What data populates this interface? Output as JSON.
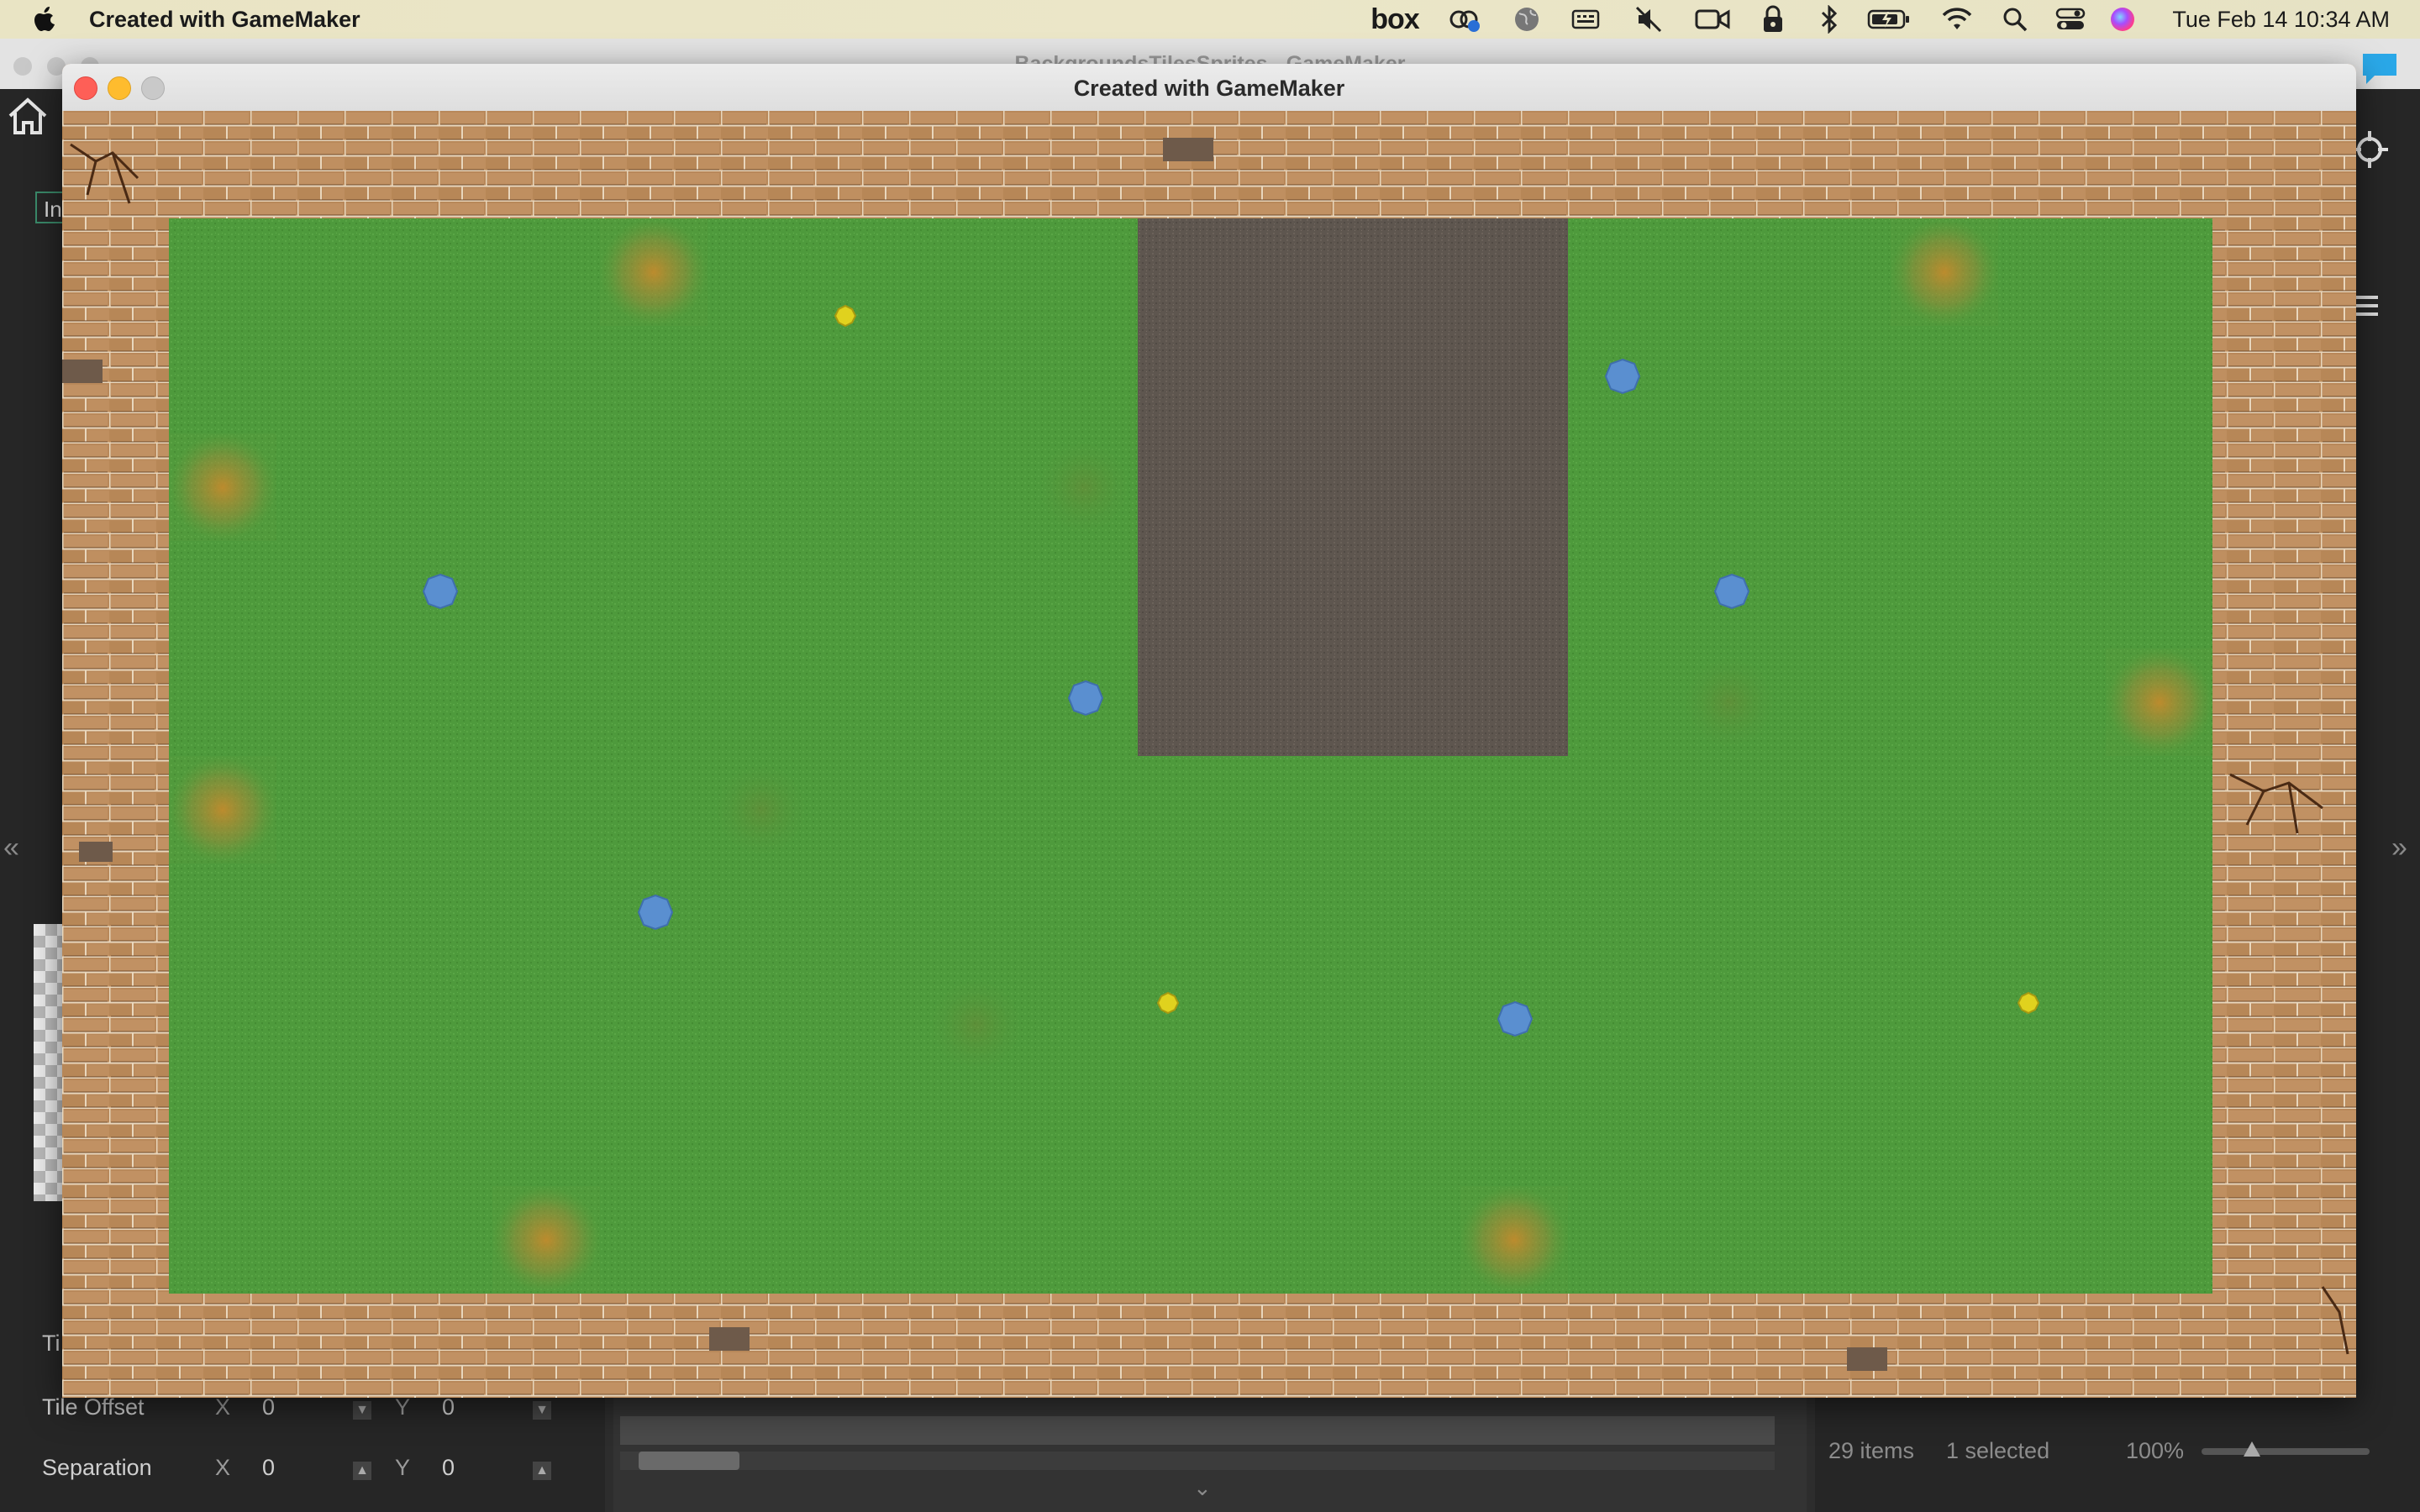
{
  "menubar": {
    "app_name": "Created with GameMaker",
    "box_label": "box",
    "clock": "Tue Feb 14  10:34 AM",
    "icons": [
      "apple-icon",
      "box-icon",
      "creative-cloud-icon",
      "globe-icon",
      "keyboard-icon",
      "mute-icon",
      "video-icon",
      "lock-icon",
      "bluetooth-icon",
      "battery-icon",
      "wifi-icon",
      "search-icon",
      "control-center-icon",
      "siri-icon"
    ]
  },
  "ide": {
    "window_title": "BackgroundsTilesSprites - GameMaker",
    "tab_fragment": "In",
    "ti_fragment": "Ti",
    "tile_offset": {
      "label": "Tile Offset",
      "x_label": "X",
      "x_value": "0",
      "y_label": "Y",
      "y_value": "0"
    },
    "separation": {
      "label": "Separation",
      "x_label": "X",
      "x_value": "0",
      "y_label": "Y",
      "y_value": "0"
    },
    "status": {
      "items": "29 items",
      "selected": "1 selected",
      "zoom": "100%"
    }
  },
  "game_window": {
    "title": "Created with GameMaker"
  },
  "colors": {
    "grass": "#4e9a3c",
    "dirt": "#5e564f",
    "brick": "#b8885a",
    "blue_flower": "#5a8fd0",
    "yellow_flower": "#e0d21e",
    "close": "#fe5f57",
    "minimize": "#febc2e"
  }
}
